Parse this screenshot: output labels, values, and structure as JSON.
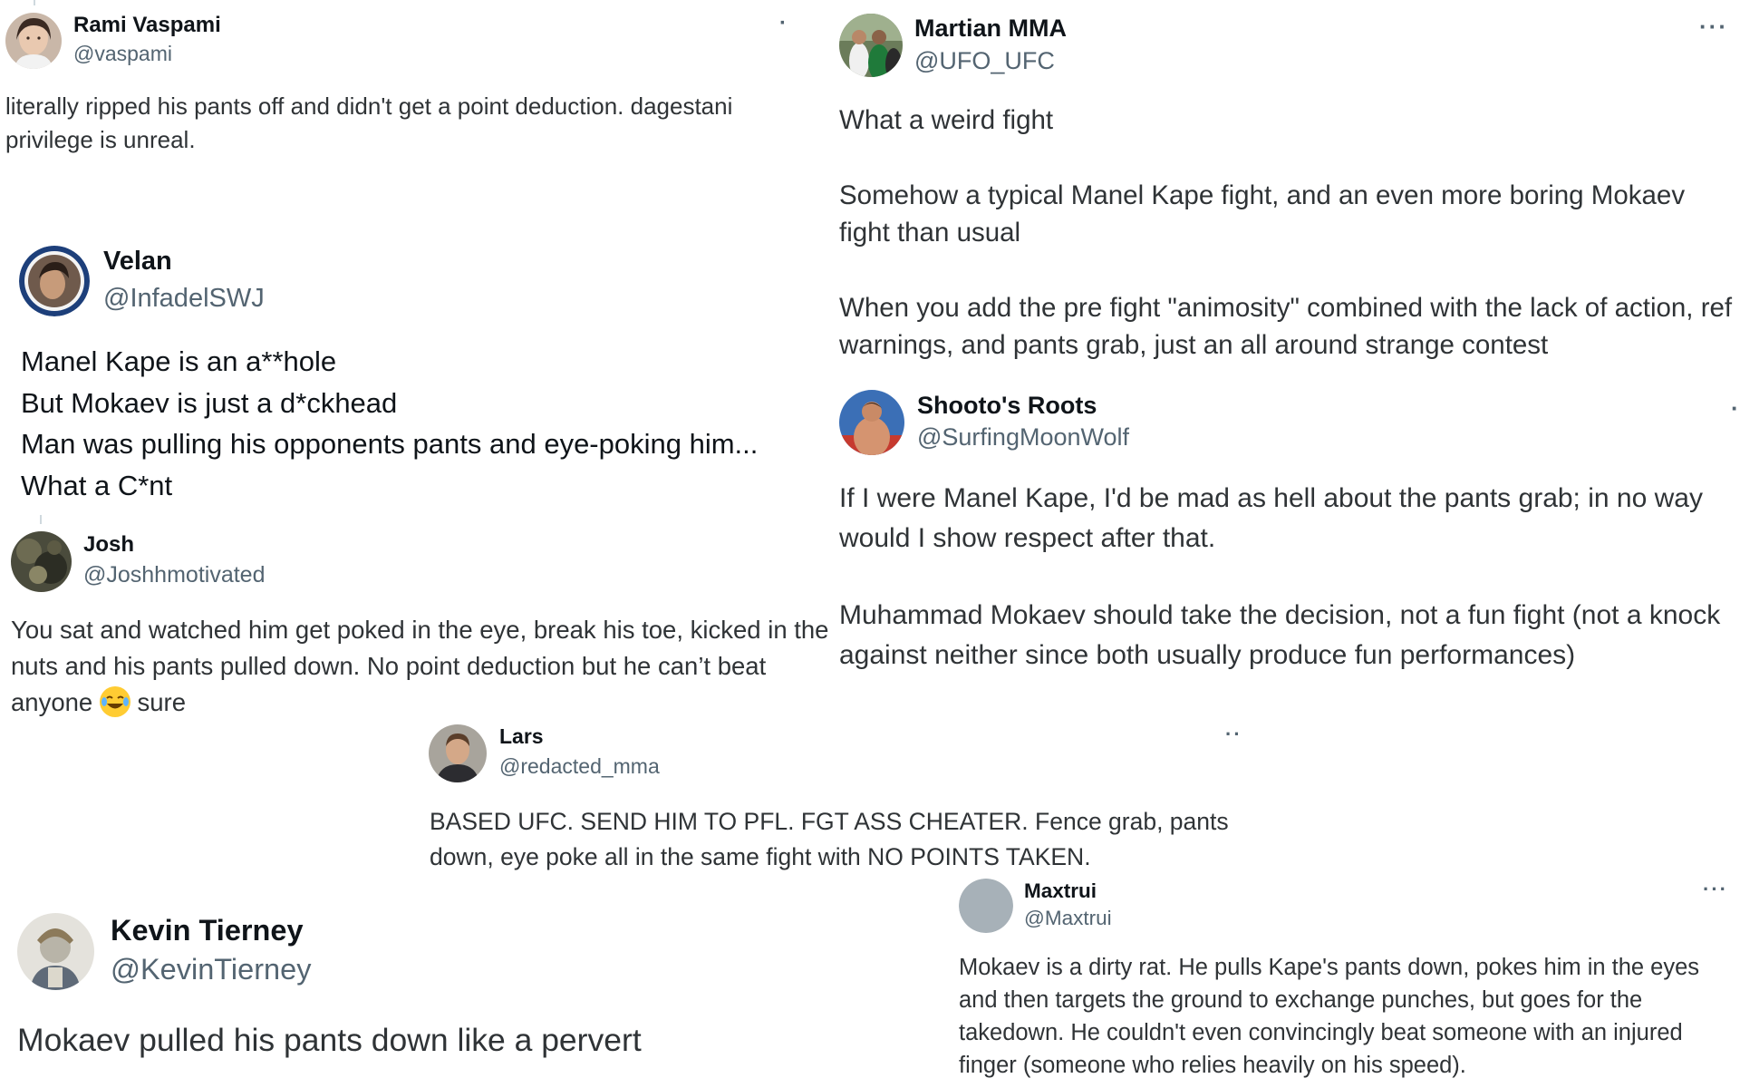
{
  "tweets": {
    "rami": {
      "name": "Rami Vaspami",
      "handle": "@vaspami",
      "more": "·",
      "text": "literally ripped his pants off and didn't get a point deduction. dagestani privilege is unreal."
    },
    "martian": {
      "name": "Martian MMA",
      "handle": "@UFO_UFC",
      "more": "···",
      "paragraphs": [
        "What a weird fight",
        "Somehow a typical Manel Kape fight, and an even more boring Mokaev fight than usual",
        "When you add the pre fight \"animosity\" combined with the lack of action, ref warnings, and pants grab, just an all around strange contest"
      ]
    },
    "velan": {
      "name": "Velan",
      "handle": "@InfadelSWJ",
      "lines": [
        "Manel Kape is an a**hole",
        "But Mokaev is just a d*ckhead",
        "Man was pulling his opponents pants and eye-poking him...",
        "What a C*nt"
      ]
    },
    "shooto": {
      "name": "Shooto's Roots",
      "handle": "@SurfingMoonWolf",
      "more": "·",
      "paragraphs": [
        "If I were Manel Kape, I'd be mad as hell about the pants grab; in no way would I show respect after that.",
        "Muhammad Mokaev should take the decision, not a fun fight (not a knock against neither since both usually produce fun performances)"
      ]
    },
    "josh": {
      "name": "Josh",
      "handle": "@Joshhmotivated",
      "text_before_emoji": "You sat and watched him get poked in the eye, break his toe, kicked in the nuts and his pants pulled down. No point deduction but he can’t beat anyone ",
      "emoji": "face-with-tears-of-joy",
      "text_after_emoji": " sure"
    },
    "lars": {
      "name": "Lars",
      "handle": "@redacted_mma",
      "more": "··",
      "text": "BASED UFC.  SEND HIM TO PFL.  FGT ASS CHEATER.  Fence grab, pants down, eye poke all in the same fight with NO POINTS TAKEN."
    },
    "kevin": {
      "name": "Kevin Tierney",
      "handle": "@KevinTierney",
      "text": "Mokaev pulled his pants down like a pervert"
    },
    "maxtrui": {
      "name": "Maxtrui",
      "handle": "@Maxtrui",
      "more": "···",
      "text": "Mokaev is a dirty rat. He pulls Kape's pants down, pokes him in the eyes and then targets the ground to exchange punches, but goes for the takedown. He couldn't even convincingly beat someone with an injured finger (someone who relies heavily on his speed)."
    }
  }
}
